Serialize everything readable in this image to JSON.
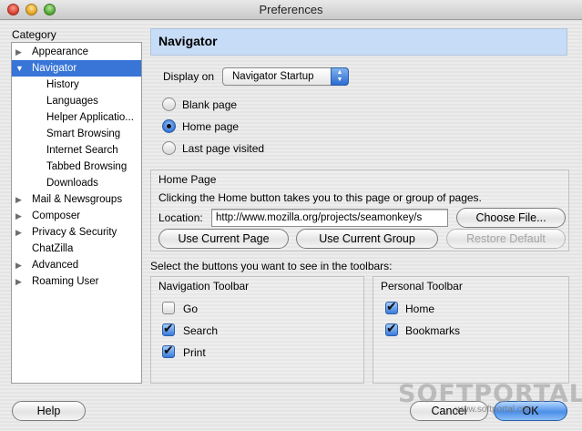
{
  "window": {
    "title": "Preferences"
  },
  "sidebar": {
    "label": "Category",
    "items": [
      {
        "label": "Appearance",
        "expander": "▶"
      },
      {
        "label": "Navigator",
        "expander": "▼"
      },
      {
        "label": "History"
      },
      {
        "label": "Languages"
      },
      {
        "label": "Helper Applicatio..."
      },
      {
        "label": "Smart Browsing"
      },
      {
        "label": "Internet Search"
      },
      {
        "label": "Tabbed Browsing"
      },
      {
        "label": "Downloads"
      },
      {
        "label": "Mail & Newsgroups",
        "expander": "▶"
      },
      {
        "label": "Composer",
        "expander": "▶"
      },
      {
        "label": "Privacy & Security",
        "expander": "▶"
      },
      {
        "label": "ChatZilla"
      },
      {
        "label": "Advanced",
        "expander": "▶"
      },
      {
        "label": "Roaming User",
        "expander": "▶"
      }
    ]
  },
  "panel": {
    "title": "Navigator",
    "display_on_label": "Display on",
    "display_on_value": "Navigator Startup",
    "startup_options": [
      {
        "label": "Blank page",
        "selected": false
      },
      {
        "label": "Home page",
        "selected": true
      },
      {
        "label": "Last page visited",
        "selected": false
      }
    ],
    "home_page": {
      "group_label": "Home Page",
      "description": "Clicking the Home button takes you to this page or group of pages.",
      "location_label": "Location:",
      "location_value": "http://www.mozilla.org/projects/seamonkey/s",
      "choose_file": "Choose File...",
      "use_current_page": "Use Current Page",
      "use_current_group": "Use Current Group",
      "restore_default": "Restore Default"
    },
    "toolbars_prompt": "Select the buttons you want to see in the toolbars:",
    "navigation_toolbar": {
      "label": "Navigation Toolbar",
      "items": [
        {
          "label": "Go",
          "checked": false
        },
        {
          "label": "Search",
          "checked": true
        },
        {
          "label": "Print",
          "checked": true
        }
      ]
    },
    "personal_toolbar": {
      "label": "Personal Toolbar",
      "items": [
        {
          "label": "Home",
          "checked": true
        },
        {
          "label": "Bookmarks",
          "checked": true
        }
      ]
    }
  },
  "footer": {
    "help": "Help",
    "cancel": "Cancel",
    "ok": "OK"
  },
  "watermark": {
    "brand": "SOFTPORTAL",
    "url": "www.softportal.com"
  },
  "colors": {
    "selection": "#3875d7",
    "header_bg": "#c7dcf6",
    "default_button": "#4b8fe8"
  }
}
